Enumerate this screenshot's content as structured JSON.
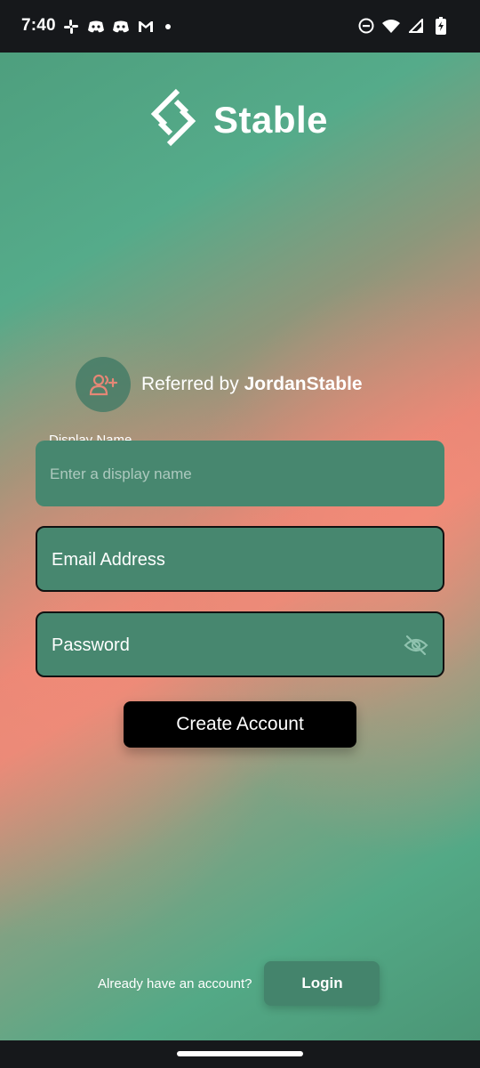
{
  "status_bar": {
    "time": "7:40",
    "left_icons": [
      "slack-icon",
      "discord-icon",
      "discord-icon",
      "gmail-icon",
      "notification-dot-icon"
    ],
    "right_icons": [
      "do-not-disturb-icon",
      "wifi-icon",
      "signal-icon",
      "battery-charging-icon"
    ]
  },
  "logo": {
    "text": "Stable"
  },
  "referral": {
    "prefix": "Referred by ",
    "referrer": "JordanStable",
    "icon": "add-user-icon"
  },
  "form": {
    "display_name": {
      "label": "Display Name",
      "placeholder": "Enter a display name",
      "value": ""
    },
    "email": {
      "placeholder": "Email Address",
      "value": ""
    },
    "password": {
      "placeholder": "Password",
      "value": "",
      "visibility_icon": "eye-off-icon"
    },
    "submit_label": "Create Account"
  },
  "footer": {
    "question": "Already have an account?",
    "login_label": "Login"
  },
  "colors": {
    "field_bg": "#47876f",
    "accent_coral": "#e58776",
    "green": "#55ab8a",
    "button_black": "#000000"
  }
}
